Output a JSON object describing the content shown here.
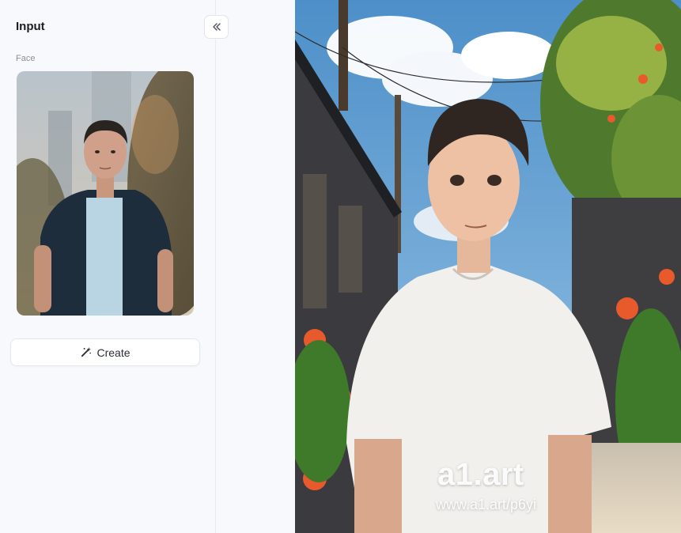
{
  "sidebar": {
    "title": "Input",
    "face_section_label": "Face",
    "face_image_icon": "portrait-photo",
    "create_button_label": "Create",
    "create_icon": "magic-wand-icon",
    "collapse_icon": "double-chevron-left-icon"
  },
  "output": {
    "watermark_brand": "a1.art",
    "watermark_url": "www.a1.art/p6yi"
  },
  "colors": {
    "sidebar_bg": "#f7f9fc",
    "button_bg": "#ffffff",
    "border": "#e3e7ee"
  }
}
